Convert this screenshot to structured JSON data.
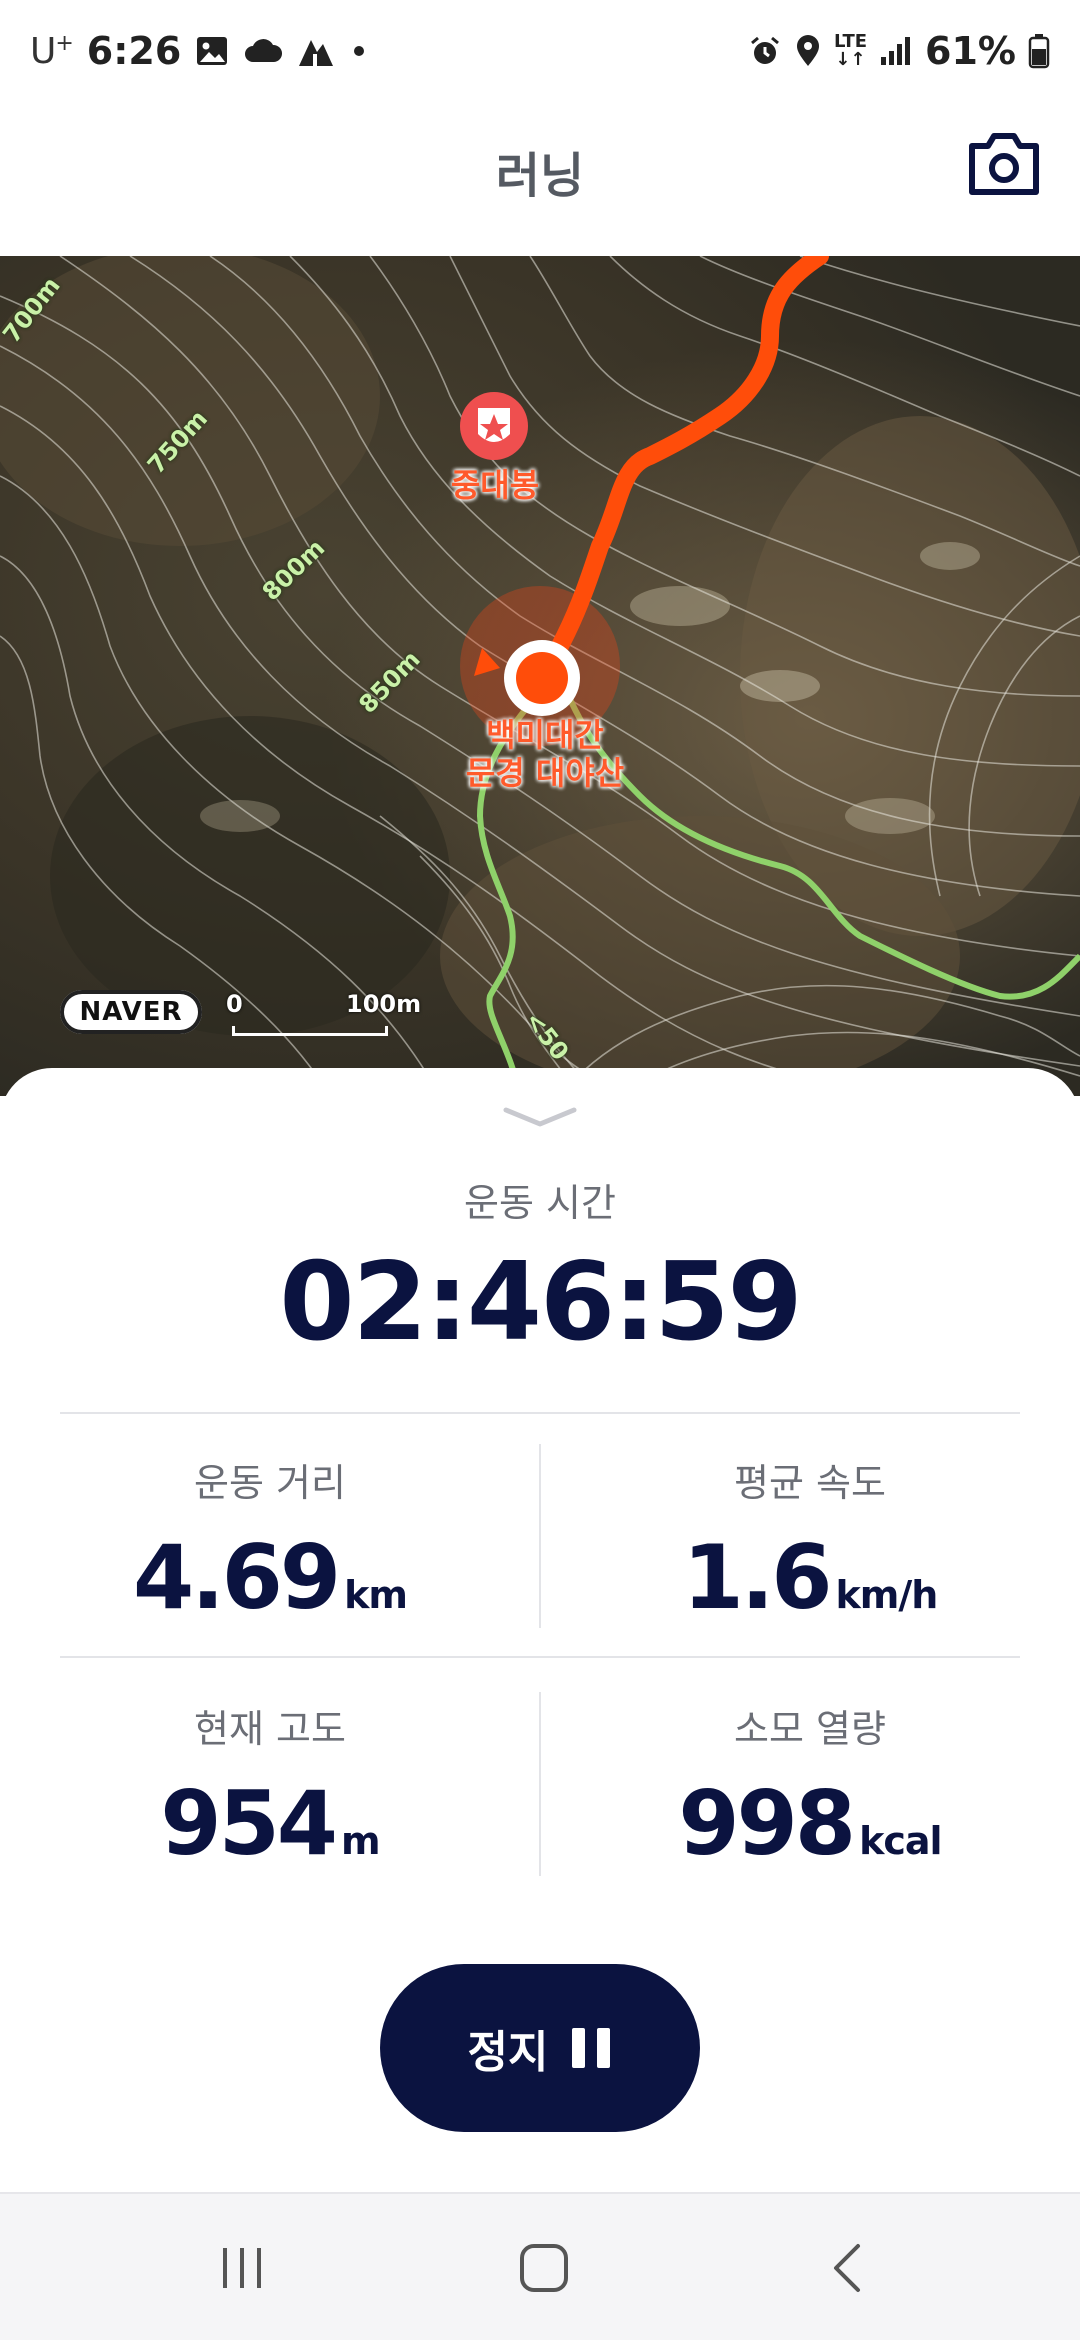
{
  "status_bar": {
    "carrier": "U",
    "carrier_sup": "+",
    "time": "6:26",
    "lte": "LTE",
    "battery": "61%"
  },
  "header": {
    "title": "러닝"
  },
  "map": {
    "provider": "NAVER",
    "scale_zero": "0",
    "scale_label": "100m",
    "poi_peak": "중대봉",
    "poi_start_line1": "백미대간",
    "poi_start_line2": "문경 대야산",
    "contours": [
      "700m",
      "750m",
      "800m",
      "850m"
    ],
    "trail_marker": "<50",
    "route_color": "#ff4d0a",
    "trail_color": "#8fd16a"
  },
  "stats": {
    "time_label": "운동 시간",
    "time_value": "02:46:59",
    "distance_label": "운동 거리",
    "distance_value": "4.69",
    "distance_unit": "km",
    "speed_label": "평균 속도",
    "speed_value": "1.6",
    "speed_unit": "km/h",
    "altitude_label": "현재 고도",
    "altitude_value": "954",
    "altitude_unit": "m",
    "calories_label": "소모 열량",
    "calories_value": "998",
    "calories_unit": "kcal"
  },
  "controls": {
    "stop_label": "정지"
  },
  "colors": {
    "navy": "#0b1340",
    "accent": "#ff4d0a"
  }
}
